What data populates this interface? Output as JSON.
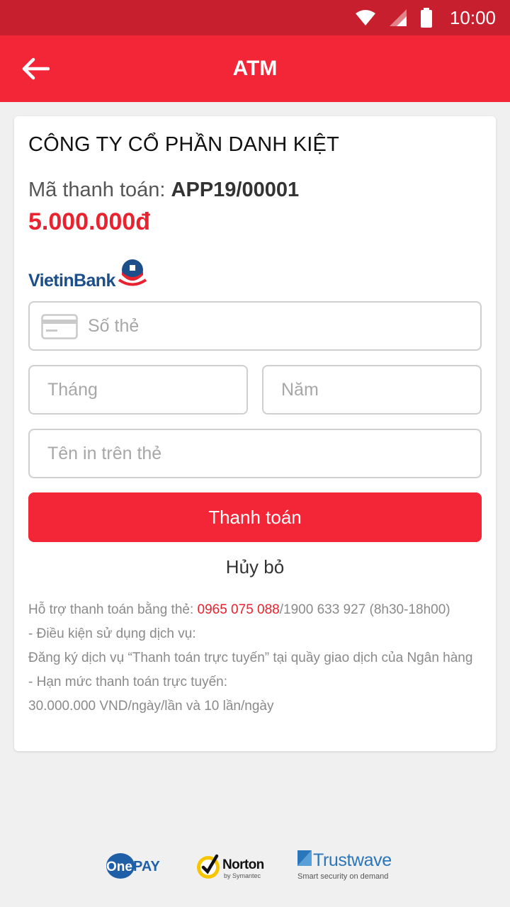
{
  "status_bar": {
    "time": "10:00",
    "icons": [
      "wifi-icon",
      "signal-icon",
      "battery-icon"
    ]
  },
  "app_bar": {
    "title": "ATM",
    "back_icon": "arrow-left-icon"
  },
  "card": {
    "company": "CÔNG TY CỔ PHẦN DANH KIỆT",
    "pay_code_label": "Mã thanh toán:",
    "pay_code_value": "APP19/00001",
    "amount": "5.000.000đ",
    "bank": {
      "name_prefix": "Vietin",
      "name_suffix": "Bank"
    },
    "form": {
      "card_number_placeholder": "Số thẻ",
      "month_placeholder": "Tháng",
      "year_placeholder": "Năm",
      "name_placeholder": "Tên in trên thẻ"
    },
    "pay_button": "Thanh toán",
    "cancel_button": "Hủy bỏ",
    "info": {
      "support_prefix": "Hỗ trợ thanh toán bằng thẻ: ",
      "support_hotline": "0965 075 088",
      "support_suffix": "/1900 633 927 (8h30-18h00)",
      "conditions_title": "- Điều kiện sử dụng dịch vụ:",
      "conditions_text": "Đăng ký dịch vụ “Thanh toán trực tuyến” tại quầy giao dịch của Ngân hàng",
      "limit_title": "- Hạn mức thanh toán trực tuyến:",
      "limit_text": "30.000.000 VND/ngày/lần và 10 lần/ngày"
    }
  },
  "partners": {
    "onepay": {
      "one": "One",
      "pay": "PAY"
    },
    "norton": {
      "name": "Norton",
      "sub": "by Symantec"
    },
    "trustwave": {
      "name": "Trustwave",
      "tagline": "Smart security on demand"
    }
  },
  "colors": {
    "primary": "#f32637",
    "status_bar": "#c71f2d",
    "amount": "#e8222e",
    "background": "#f0f0f0"
  }
}
